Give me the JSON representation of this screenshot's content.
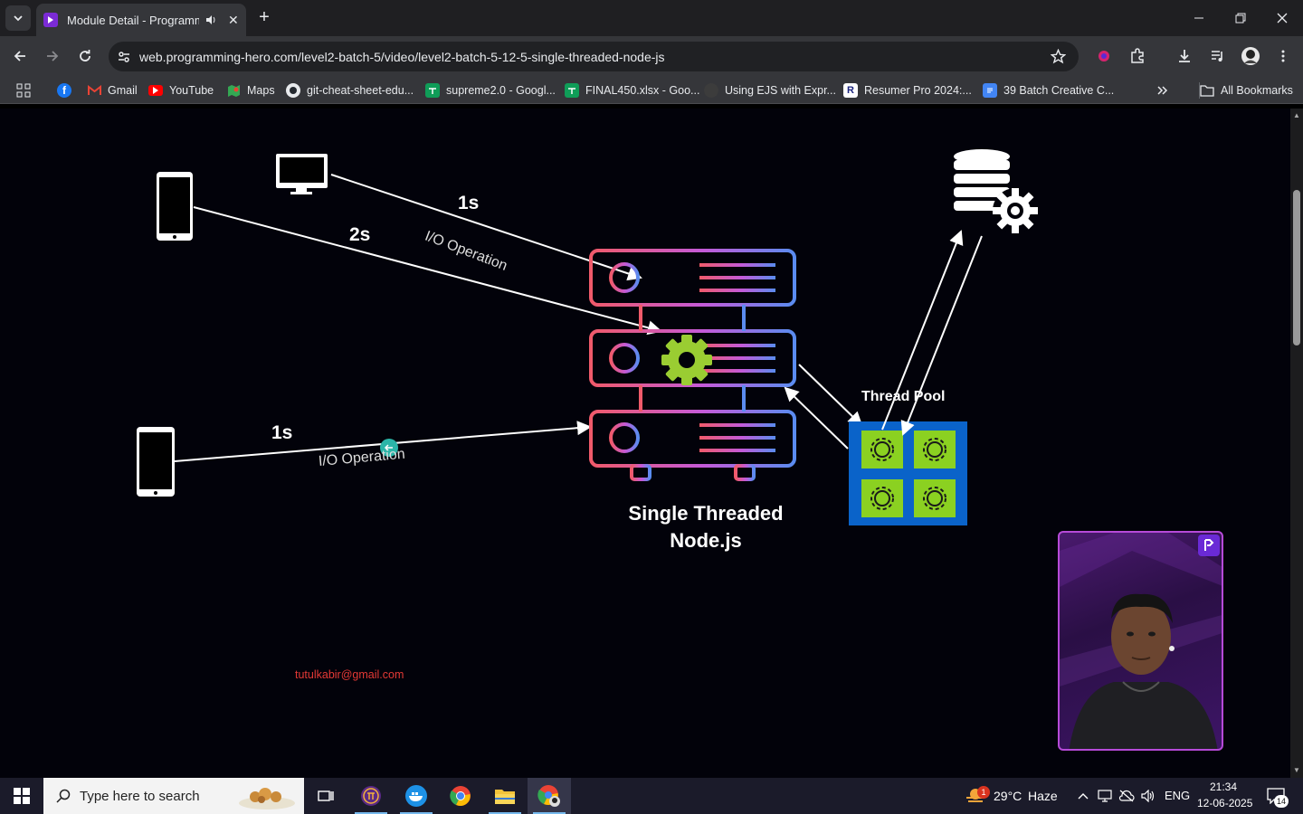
{
  "browser": {
    "tab_title": "Module Detail - Programming Hero",
    "url": "web.programming-hero.com/level2-batch-5/video/level2-batch-5-12-5-single-threaded-node-js",
    "bookmarks": [
      {
        "label": "",
        "icon": "facebook-icon"
      },
      {
        "label": "Gmail",
        "icon": "gmail-icon"
      },
      {
        "label": "YouTube",
        "icon": "youtube-icon"
      },
      {
        "label": "Maps",
        "icon": "maps-icon"
      },
      {
        "label": "git-cheat-sheet-edu...",
        "icon": "github-icon"
      },
      {
        "label": "supreme2.0 - Googl...",
        "icon": "sheets-icon"
      },
      {
        "label": "FINAL450.xlsx - Goo...",
        "icon": "sheets-icon"
      },
      {
        "label": "Using EJS with Expr...",
        "icon": "github-icon"
      },
      {
        "label": "Resumer Pro 2024:...",
        "icon": "resumer-icon"
      },
      {
        "label": "39 Batch Creative C...",
        "icon": "docs-icon"
      }
    ],
    "all_bookmarks": "All Bookmarks"
  },
  "diagram": {
    "label_1s_top": "1s",
    "label_io_top": "I/O Operation",
    "label_2s": "2s",
    "label_1s_bottom": "1s",
    "label_io_bottom": "I/O Operation",
    "thread_pool": "Thread Pool",
    "caption_line1": "Single Threaded",
    "caption_line2": "Node.js",
    "email": "tutulkabir@gmail.com"
  },
  "taskbar": {
    "search_placeholder": "Type here to search",
    "weather_temp": "29°C",
    "weather_desc": "Haze",
    "language": "ENG",
    "time": "21:34",
    "date": "12-06-2025",
    "notifications": "14",
    "weather_badge": "1"
  }
}
